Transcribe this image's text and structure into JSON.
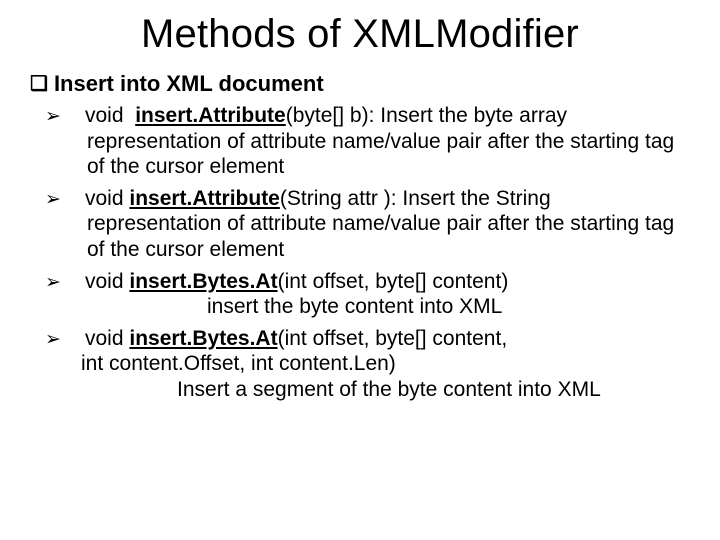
{
  "title": "Methods of XMLModifier",
  "section": {
    "bullet": "❑",
    "heading": "Insert into XML document"
  },
  "arrows": "➢",
  "items": {
    "m0": {
      "ret": "void  ",
      "name": "insert.Attribute",
      "sigpost": "(byte[] b): Insert the byte array representation of attribute name/value pair after the starting tag of the cursor element"
    },
    "m1": {
      "ret": "void ",
      "name": "insert.Attribute",
      "sigpost": "(String attr ): Insert the String representation of attribute name/value pair after the starting tag of the cursor element"
    },
    "m2": {
      "ret": "void ",
      "name": "insert.Bytes.At",
      "sigpost": "(int offset, byte[] content)",
      "desc": "insert the byte content into XML"
    },
    "m3": {
      "ret": "void ",
      "name": "insert.Bytes.At",
      "sigpost": "(int offset, byte[] content,",
      "line2": "int content.Offset, int content.Len)",
      "desc": "Insert a segment of the byte content into XML"
    }
  }
}
